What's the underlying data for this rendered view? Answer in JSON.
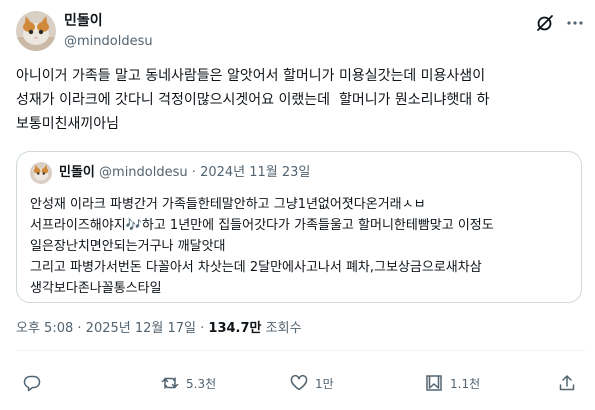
{
  "author": {
    "name": "민돌이",
    "handle": "@mindoldesu"
  },
  "tweet": {
    "text": "아니이거 가족들 말고 동네사람들은 알앗어서 할머니가 미용실갓는데 미용사샘이\n성재가 이라크에 갓다니 걱정이많으시겟어요 이랬는데  할머니가 뭔소리냐햇대 하\n보통미친새끼아님"
  },
  "quote": {
    "name": "민돌이",
    "handle": "@mindoldesu",
    "separator": "·",
    "date": "2024년 11월 23일",
    "text": "안성재 이라크 파병간거 가족들한테말안하고 그냥1년없어졋다온거래ㅅㅂ\n서프라이즈해야지🎶하고 1년만에 집들어갓다가 가족들울고 할머니한테빰맞고 이정도\n일은장난치면안되는거구나 깨달앗대\n그리고 파병가서번돈 다꼴아서 차삿는데 2달만에사고나서 폐차,그보상금으로새차삼\n생각보다존나꼴통스타일"
  },
  "meta": {
    "time": "오후 5:08",
    "separator": "·",
    "date": "2025년 12월 17일",
    "views": "134.7만",
    "views_label": "조회수"
  },
  "actions": {
    "reply_count": "",
    "retweet_count": "5.3천",
    "like_count": "1만",
    "bookmark_count": "1.1천"
  },
  "colors": {
    "text": "#0f1419",
    "secondary": "#536471",
    "border": "#cfd9de"
  },
  "icons": [
    "grok-icon",
    "more-icon",
    "reply-icon",
    "retweet-icon",
    "like-icon",
    "bookmark-icon",
    "share-icon"
  ]
}
